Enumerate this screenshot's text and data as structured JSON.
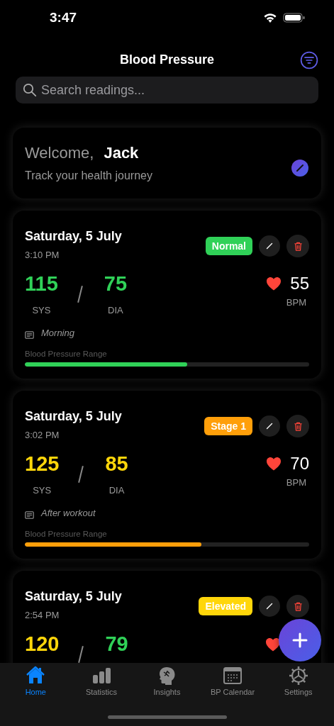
{
  "status_bar": {
    "time": "3:47"
  },
  "header": {
    "title": "Blood Pressure"
  },
  "search": {
    "placeholder": "Search readings..."
  },
  "welcome": {
    "greeting": "Welcome,",
    "name": "Jack",
    "subtitle": "Track your health journey"
  },
  "readings": [
    {
      "date": "Saturday, 5 July",
      "time": "3:10 PM",
      "category": "Normal",
      "color": "#30d158",
      "systolic": {
        "value": "115",
        "label": "SYS",
        "color": "#30d158"
      },
      "diastolic": {
        "value": "75",
        "label": "DIA",
        "color": "#30d158"
      },
      "pulse": {
        "value": "55",
        "label": "BPM"
      },
      "note": "Morning",
      "range_label": "Blood Pressure Range",
      "level": 0.57
    },
    {
      "date": "Saturday, 5 July",
      "time": "3:02 PM",
      "category": "Stage 1",
      "color": "#ff9f0a",
      "systolic": {
        "value": "125",
        "label": "SYS",
        "color": "#ffd60a"
      },
      "diastolic": {
        "value": "85",
        "label": "DIA",
        "color": "#ffd60a"
      },
      "pulse": {
        "value": "70",
        "label": "BPM"
      },
      "note": "After workout",
      "range_label": "Blood Pressure Range",
      "level": 0.62
    },
    {
      "date": "Saturday, 5 July",
      "time": "2:54 PM",
      "category": "Elevated",
      "color": "#ffd60a",
      "systolic": {
        "value": "120",
        "color": "#ffd60a"
      },
      "diastolic": {
        "value": "79",
        "color": "#30d158"
      }
    }
  ],
  "tabs": [
    {
      "label": "Home",
      "selected": true
    },
    {
      "label": "Statistics",
      "selected": false
    },
    {
      "label": "Insights",
      "selected": false
    },
    {
      "label": "BP Calendar",
      "selected": false
    },
    {
      "label": "Settings",
      "selected": false
    }
  ]
}
